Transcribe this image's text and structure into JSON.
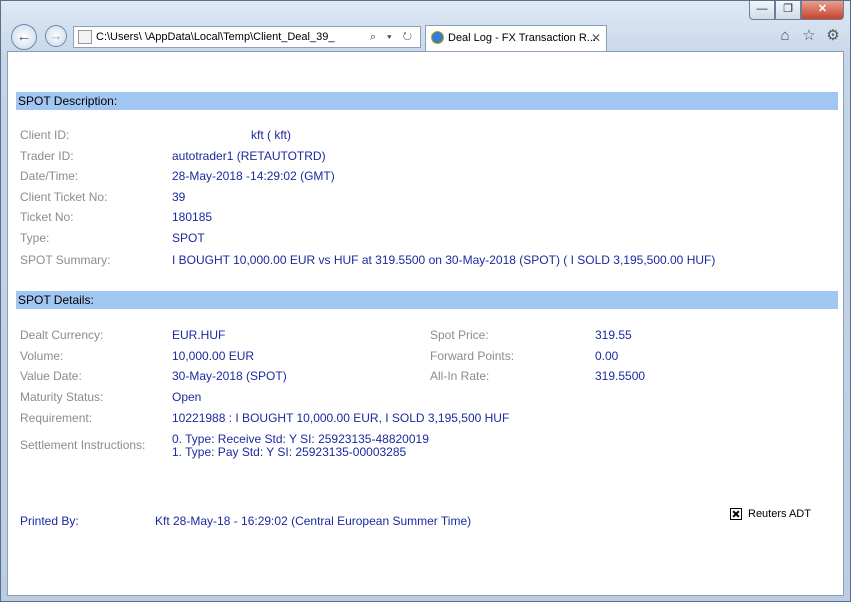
{
  "browser": {
    "address": "C:\\Users\\            \\AppData\\Local\\Temp\\Client_Deal_39_",
    "tab_title": "Deal Log - FX Transaction R...",
    "tab_close": "✕",
    "controls": {
      "minimize": "—",
      "restore": "❐",
      "close": "✕"
    },
    "back_glyph": "←",
    "forward_glyph": "→",
    "address_tools": "⌕ ▾ ↻",
    "tools": {
      "home": "⌂",
      "favorites": "☆",
      "settings": "⚙"
    }
  },
  "description": {
    "header": "SPOT Description:",
    "rows": [
      {
        "label": "Client ID:",
        "value": "kft (                    kft)"
      },
      {
        "label": "Trader ID:",
        "value": "autotrader1 (RETAUTOTRD)"
      },
      {
        "label": "Date/Time:",
        "value": "28-May-2018 -14:29:02 (GMT)"
      },
      {
        "label": "Client Ticket No:",
        "value": "39"
      },
      {
        "label": "Ticket No:",
        "value": "180185"
      },
      {
        "label": "Type:",
        "value": "SPOT"
      },
      {
        "label": "SPOT Summary:",
        "value": "I BOUGHT 10,000.00 EUR vs HUF at 319.5500 on 30-May-2018 (SPOT) ( I SOLD 3,195,500.00 HUF)"
      }
    ]
  },
  "details": {
    "header": "SPOT Details:",
    "left": [
      {
        "label": "Dealt Currency:",
        "value": "EUR.HUF"
      },
      {
        "label": "Volume:",
        "value": "10,000.00 EUR"
      },
      {
        "label": "Value Date:",
        "value": "30-May-2018 (SPOT)"
      },
      {
        "label": "Maturity Status:",
        "value": "Open"
      },
      {
        "label": "Requirement:",
        "value": "10221988 : I BOUGHT 10,000.00 EUR, I SOLD 3,195,500 HUF"
      }
    ],
    "right": [
      {
        "label": "Spot Price:",
        "value": "319.55"
      },
      {
        "label": "Forward Points:",
        "value": "0.00"
      },
      {
        "label": "All-In Rate:",
        "value": "319.5500"
      }
    ],
    "settlement": {
      "label": "Settlement Instructions:",
      "lines": [
        "0. Type: Receive Std: Y SI: 25923135-48820019",
        "1. Type: Pay Std: Y SI: 25923135-00003285"
      ]
    }
  },
  "footer": {
    "printed_label": "Printed By:",
    "printed_value": "Kft 28-May-18 - 16:29:02 (Central European Summer Time)",
    "reuters_label": "Reuters ADT"
  }
}
